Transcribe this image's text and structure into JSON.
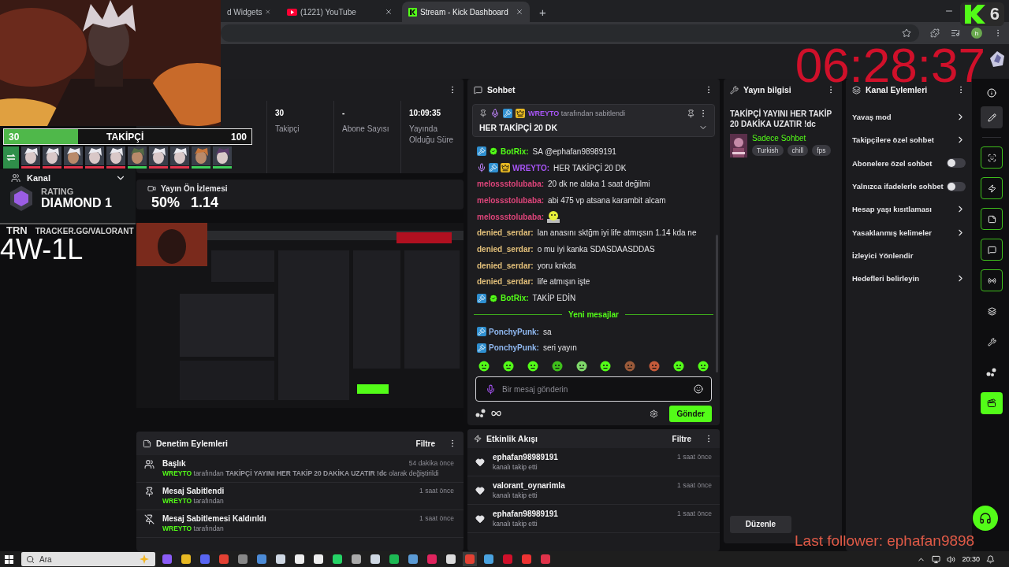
{
  "browser": {
    "tabs": [
      {
        "title": "d Widgets",
        "kind": "plain",
        "selected": false
      },
      {
        "title": "(1221) YouTube",
        "kind": "video",
        "selected": false
      },
      {
        "title": "Stream - Kick Dashboard",
        "kind": "kick",
        "selected": true
      }
    ],
    "new_tab": "+",
    "profile": "h"
  },
  "overlay": {
    "follower_goal": {
      "current": "30",
      "label": "TAKİPÇİ",
      "target": "100",
      "level": 0.3
    },
    "agents": [
      {
        "color": "#e0334a"
      },
      {
        "color": "#e0334a"
      },
      {
        "color": "#e0334a"
      },
      {
        "color": "#e0334a"
      },
      {
        "color": "#e0334a"
      },
      {
        "color": "#3ecf5a"
      },
      {
        "color": "#e0334a"
      },
      {
        "color": "#e0334a"
      },
      {
        "color": "#3ecf5a"
      },
      {
        "color": "#3ecf5a"
      }
    ],
    "channel_menu": "Kanal",
    "rank": {
      "label": "RATING",
      "value": "DIAMOND 1"
    },
    "win_rate": "50%",
    "kd": "1.14",
    "tracker": {
      "brand": "TRN",
      "site": "TRACKER.GG/VALORANT"
    },
    "record": "4W-1L",
    "clock": "06:28:37",
    "logo_count": "6",
    "last_follower": "Last follower: ephafan9898"
  },
  "stats": [
    {
      "value": "30",
      "label": "Takipçi"
    },
    {
      "value": "-",
      "label": "Abone Sayısı"
    },
    {
      "value": "10:09:35",
      "label": "Yayında Olduğu Süre"
    }
  ],
  "preview": {
    "title": "Yayın Ön İzlemesi"
  },
  "moderation": {
    "title": "Denetim Eylemleri",
    "filter": "Filtre",
    "items": [
      {
        "kind": "title",
        "title": "Başlık",
        "time": "54 dakika önce",
        "by_user": "WREYTO",
        "detail": "tarafından **TAKİPÇİ YAYINI HER TAKİP 20 DAKİKA UZATIR !dc** olarak değiştirildi"
      },
      {
        "kind": "pin",
        "title": "Mesaj Sabitlendi",
        "time": "1 saat önce",
        "by_user": "WREYTO",
        "detail": "tarafından"
      },
      {
        "kind": "unpin",
        "title": "Mesaj Sabitlemesi Kaldırıldı",
        "time": "1 saat önce",
        "by_user": "WREYTO",
        "detail": "tarafından"
      }
    ]
  },
  "chat": {
    "title": "Sohbet",
    "pinned": {
      "broadcaster": true,
      "moderator": true,
      "vip": true,
      "by_user": "WREYTO",
      "by_text": "tarafından sabitlendi",
      "message": "HER TAKİPÇİ 20 DK"
    },
    "messages": [
      {
        "kind": "text",
        "moderator": true,
        "verified": true,
        "user": "BotRix:",
        "color": "#53fc18",
        "text": "SA @ephafan98989191"
      },
      {
        "kind": "text",
        "broadcaster": true,
        "moderator": true,
        "vip": true,
        "user": "WREYTO:",
        "color": "#a855f7",
        "text": "HER TAKİPÇİ 20 DK"
      },
      {
        "kind": "text",
        "user": "melossstolubaba:",
        "color": "#e0457b",
        "text": "20 dk ne alaka 1 saat değilmi"
      },
      {
        "kind": "text",
        "user": "melossstolubaba:",
        "color": "#e0457b",
        "text": "abi 475 vp atsana karambit alcam"
      },
      {
        "kind": "emote",
        "user": "melossstolubaba:",
        "color": "#e0457b"
      },
      {
        "kind": "text",
        "user": "denied_serdar:",
        "color": "#e3c07a",
        "text": "lan anasını sktğm iyi life atmışsın 1.14 kda ne"
      },
      {
        "kind": "text",
        "user": "denied_serdar:",
        "color": "#e3c07a",
        "text": "o mu iyi kanka SDASDAASDDAS"
      },
      {
        "kind": "text",
        "user": "denied_serdar:",
        "color": "#e3c07a",
        "text": "yoru knkda"
      },
      {
        "kind": "text",
        "user": "denied_serdar:",
        "color": "#e3c07a",
        "text": "life atmışın işte"
      },
      {
        "kind": "text",
        "moderator": true,
        "verified": true,
        "user": "BotRix:",
        "color": "#53fc18",
        "text": "TAKİP EDİN"
      }
    ],
    "new_divider": "Yeni mesajlar",
    "new_messages": [
      {
        "kind": "text",
        "moderator": true,
        "user": "PonchyPunk:",
        "color": "#8fb8f0",
        "text": "sa"
      },
      {
        "kind": "text",
        "moderator": true,
        "user": "PonchyPunk:",
        "color": "#8fb8f0",
        "text": "seri yayın"
      }
    ],
    "input": {
      "placeholder": "Bir mesaj gönderin"
    },
    "send": "Gönder"
  },
  "activity": {
    "title": "Etkinlik Akışı",
    "filter": "Filtre",
    "items": [
      {
        "user": "ephafan98989191",
        "action": "kanalı takip etti",
        "time": "1 saat önce"
      },
      {
        "user": "valorant_oynarimla",
        "action": "kanalı takip etti",
        "time": "1 saat önce"
      },
      {
        "user": "ephafan98989191",
        "action": "kanalı takip etti",
        "time": "1 saat önce"
      }
    ]
  },
  "stream_info": {
    "title": "Yayın bilgisi",
    "stream_title": "TAKİPÇİ YAYINI HER TAKİP 20 DAKİKA UZATIR !dc",
    "category": "Sadece Sohbet",
    "tags": [
      "Turkish",
      "chill",
      "fps"
    ],
    "edit": "Düzenle"
  },
  "channel_actions": {
    "title": "Kanal Eylemleri",
    "items": [
      {
        "label": "Yavaş mod",
        "kind": "link"
      },
      {
        "label": "Takipçilere özel sohbet",
        "kind": "link"
      },
      {
        "label": "Abonelere özel sohbet",
        "kind": "toggle",
        "on": false
      },
      {
        "label": "Yalnızca ifadelerle sohbet",
        "kind": "toggle",
        "on": false
      },
      {
        "label": "Hesap yaşı kısıtlaması",
        "kind": "link"
      },
      {
        "label": "Yasaklanmış kelimeler",
        "kind": "link"
      },
      {
        "label": "İzleyici Yönlendir",
        "kind": "plain"
      },
      {
        "label": "Hedefleri belirleyin",
        "kind": "link"
      }
    ]
  },
  "taskbar": {
    "search": {
      "placeholder": "Ara"
    },
    "clock": "20:30"
  }
}
